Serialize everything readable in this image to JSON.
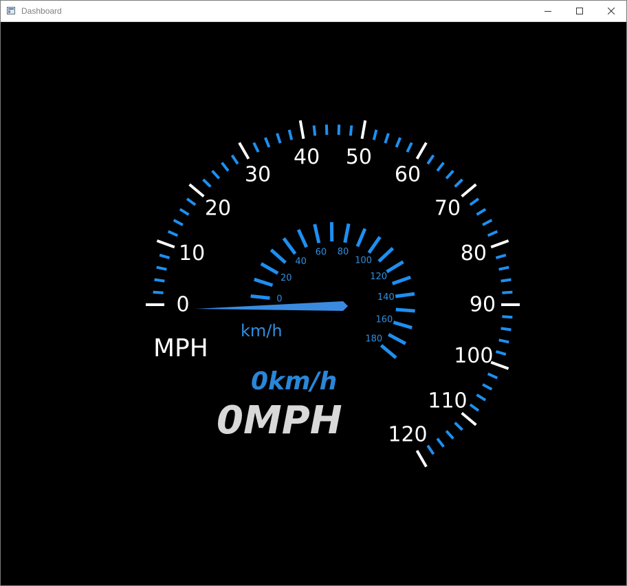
{
  "window": {
    "title": "Dashboard"
  },
  "gauge": {
    "mph_labels": [
      "0",
      "10",
      "20",
      "30",
      "40",
      "50",
      "60",
      "70",
      "80",
      "90",
      "100",
      "110",
      "120"
    ],
    "kmh_labels": [
      "0",
      "20",
      "40",
      "60",
      "80",
      "100",
      "120",
      "140",
      "160",
      "180"
    ],
    "mph_unit": "MPH",
    "kmh_unit": "km/h",
    "speed_mph": 0,
    "speed_kmh": 0,
    "readout_kmh": "0km/h",
    "readout_mph": "0MPH",
    "colors": {
      "accent": "#1e8ff0",
      "major_tick": "#ffffff",
      "needle": "#3a8be0",
      "background": "#000000"
    }
  }
}
